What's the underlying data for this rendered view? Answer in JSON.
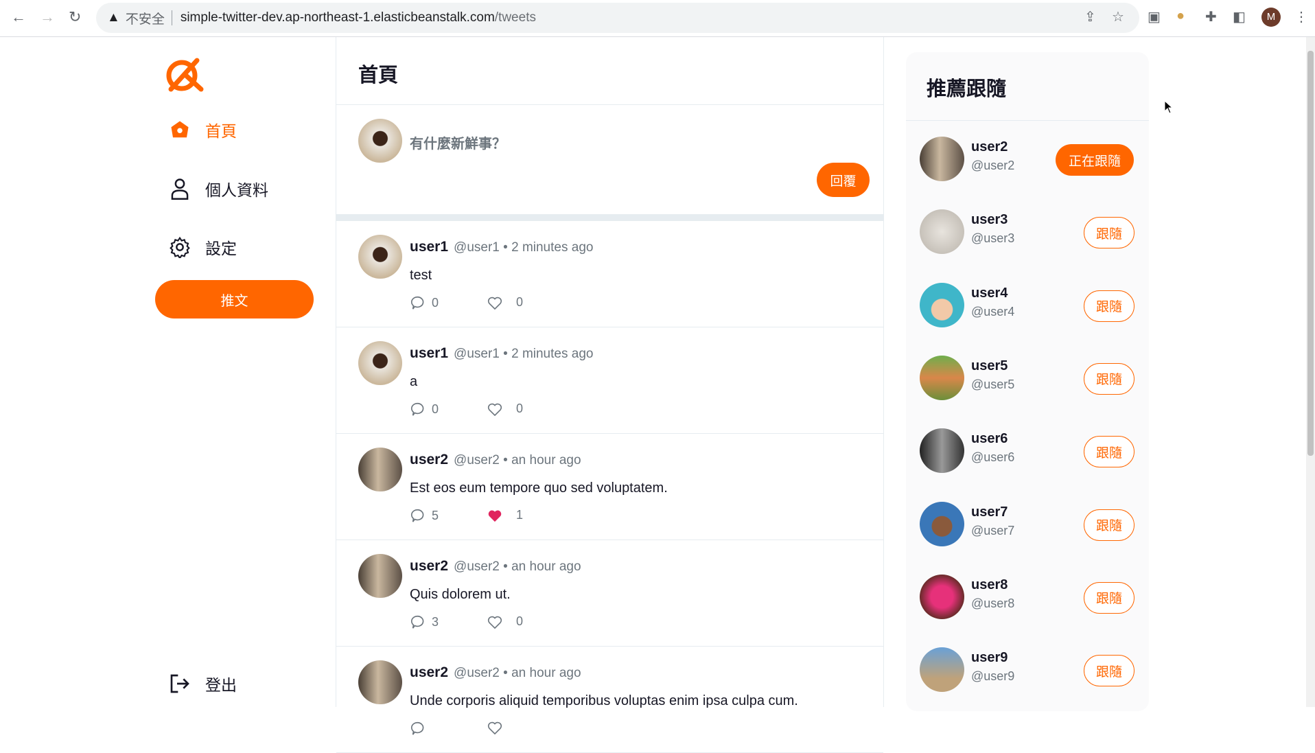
{
  "browser": {
    "security": "不安全",
    "url_host": "simple-twitter-dev.ap-northeast-1.elasticbeanstalk.com",
    "url_path": "/tweets",
    "profile_initial": "M"
  },
  "sidebar": {
    "items": [
      {
        "label": "首頁",
        "icon": "home-icon",
        "active": true
      },
      {
        "label": "個人資料",
        "icon": "user-icon"
      },
      {
        "label": "設定",
        "icon": "gear-icon"
      }
    ],
    "tweet_button": "推文",
    "logout": "登出"
  },
  "colors": {
    "accent": "#ff6600",
    "liked": "#e0245e"
  },
  "main": {
    "title": "首頁",
    "compose": {
      "placeholder": "有什麼新鮮事？",
      "button": "回覆"
    },
    "tweets": [
      {
        "name": "user1",
        "handle": "@user1",
        "time": "2 minutes ago",
        "text": "test",
        "replies": "0",
        "likes": "0",
        "liked": false
      },
      {
        "name": "user1",
        "handle": "@user1",
        "time": "2 minutes ago",
        "text": "a",
        "replies": "0",
        "likes": "0",
        "liked": false
      },
      {
        "name": "user2",
        "handle": "@user2",
        "time": "an hour ago",
        "text": "Est eos eum tempore quo sed voluptatem.",
        "replies": "5",
        "likes": "1",
        "liked": true
      },
      {
        "name": "user2",
        "handle": "@user2",
        "time": "an hour ago",
        "text": "Quis dolorem ut.",
        "replies": "3",
        "likes": "0",
        "liked": false
      },
      {
        "name": "user2",
        "handle": "@user2",
        "time": "an hour ago",
        "text": "Unde corporis aliquid temporibus voluptas enim ipsa culpa cum.",
        "replies": "",
        "likes": "",
        "liked": false
      }
    ]
  },
  "recommend": {
    "title": "推薦跟隨",
    "users": [
      {
        "name": "user2",
        "handle": "@user2",
        "button": "正在跟隨",
        "following": true
      },
      {
        "name": "user3",
        "handle": "@user3",
        "button": "跟隨",
        "following": false
      },
      {
        "name": "user4",
        "handle": "@user4",
        "button": "跟隨",
        "following": false
      },
      {
        "name": "user5",
        "handle": "@user5",
        "button": "跟隨",
        "following": false
      },
      {
        "name": "user6",
        "handle": "@user6",
        "button": "跟隨",
        "following": false
      },
      {
        "name": "user7",
        "handle": "@user7",
        "button": "跟隨",
        "following": false
      },
      {
        "name": "user8",
        "handle": "@user8",
        "button": "跟隨",
        "following": false
      },
      {
        "name": "user9",
        "handle": "@user9",
        "button": "跟隨",
        "following": false
      }
    ]
  }
}
